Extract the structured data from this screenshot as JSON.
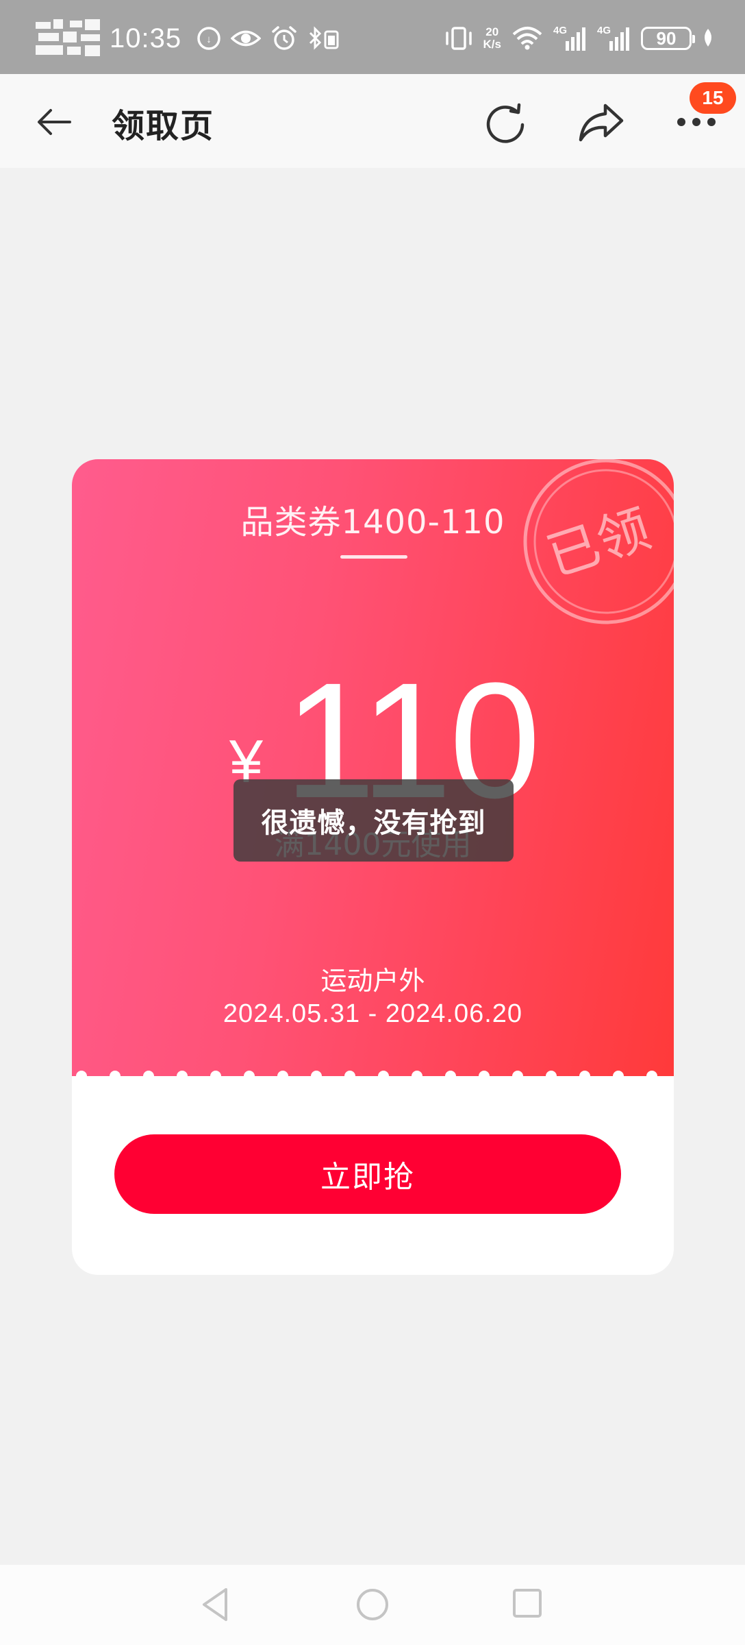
{
  "status_bar": {
    "time": "10:35",
    "network_speed_value": "20",
    "network_speed_unit": "K/s",
    "signal_1_label": "4G",
    "signal_2_label": "4G",
    "battery_level": "90",
    "icons": [
      "avatar-pixel-icon",
      "data-saver-icon",
      "eye-comfort-icon",
      "alarm-icon",
      "bluetooth-icon",
      "vibrate-icon",
      "wifi-icon",
      "signal-icon",
      "leaf-icon"
    ]
  },
  "top_nav": {
    "title": "领取页",
    "badge_count": "15",
    "icons": [
      "back-arrow-icon",
      "refresh-icon",
      "share-icon",
      "more-icon"
    ]
  },
  "coupon": {
    "name": "品类券1400-110",
    "stamp_text": "已领",
    "currency_symbol": "¥",
    "amount": "110",
    "threshold": "满1400元使用",
    "category": "运动户外",
    "validity": "2024.05.31 - 2024.06.20",
    "button_label": "立即抢",
    "colors": {
      "gradient_start": "#ff5c8d",
      "gradient_end": "#ff3a3a",
      "button": "#ff0033"
    }
  },
  "toast": {
    "message": "很遗憾，没有抢到"
  },
  "system_nav": {
    "icons": [
      "nav-back-triangle-icon",
      "nav-home-circle-icon",
      "nav-recent-square-icon"
    ]
  }
}
